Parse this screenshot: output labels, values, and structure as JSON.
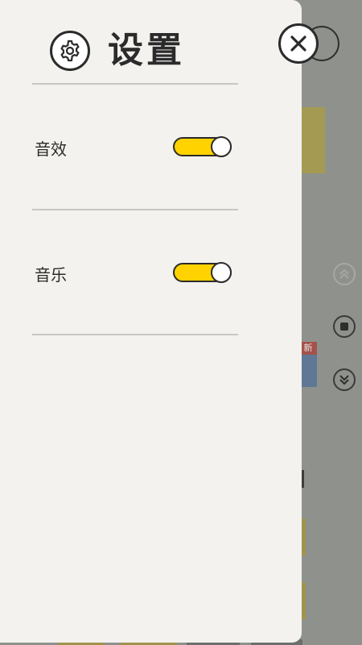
{
  "panel": {
    "title": "设置",
    "settings": [
      {
        "label": "音效",
        "enabled": true
      },
      {
        "label": "音乐",
        "enabled": true
      }
    ]
  },
  "background": {
    "new_tag": "新"
  },
  "colors": {
    "toggle_on": "#ffd200",
    "panel_bg": "#f4f2ee",
    "outline": "#2b2b2b"
  },
  "icons": {
    "header": "gear-icon",
    "close": "close-icon"
  }
}
